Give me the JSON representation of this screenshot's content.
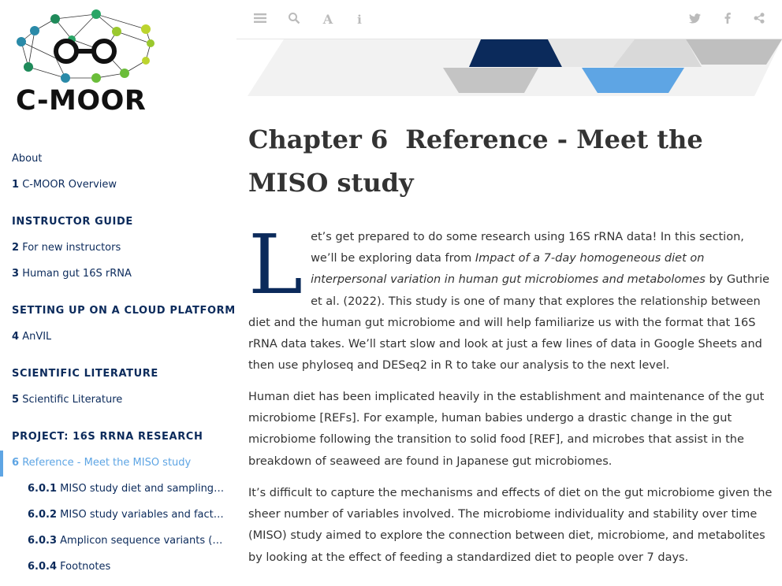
{
  "brand": {
    "logo_text": "C-MOOR",
    "colors": {
      "navy": "#0b2a5b",
      "accent": "#5ea5e4",
      "green": "#1f8a5a",
      "lime": "#9ac82e",
      "teal": "#2a8aa8"
    }
  },
  "sidebar": {
    "about": "About",
    "ch1": {
      "num": "1",
      "label": "C-MOOR Overview"
    },
    "sec_instructor": "Instructor Guide",
    "ch2": {
      "num": "2",
      "label": "For new instructors"
    },
    "ch3": {
      "num": "3",
      "label": "Human gut 16S rRNA"
    },
    "sec_cloud": "Setting up on a cloud platform",
    "ch4": {
      "num": "4",
      "label": "AnVIL"
    },
    "sec_lit": "Scientific Literature",
    "ch5": {
      "num": "5",
      "label": "Scientific Literature"
    },
    "sec_project": "Project: 16S rRNA Research",
    "ch6": {
      "num": "6",
      "label": "Reference - Meet the MISO study"
    },
    "s601": {
      "num": "6.0.1",
      "label": "MISO study diet and sampling s…"
    },
    "s602": {
      "num": "6.0.2",
      "label": "MISO study variables and factors"
    },
    "s603": {
      "num": "6.0.3",
      "label": "Amplicon sequence variants (A…"
    },
    "s604": {
      "num": "6.0.4",
      "label": "Footnotes"
    }
  },
  "toolbar": {
    "left_icons": [
      "menu-icon",
      "search-icon",
      "font-icon",
      "info-icon"
    ],
    "right_icons": [
      "twitter-icon",
      "facebook-icon",
      "share-icon"
    ]
  },
  "chapter": {
    "num": "Chapter 6",
    "title": "Reference - Meet the MISO study"
  },
  "content": {
    "dropcap": "L",
    "p1_a": "et’s get prepared to do some research using 16S rRNA data! In this section, we’ll be exploring data from ",
    "p1_em": "Impact of a 7-day homogeneous diet on interpersonal variation in human gut microbiomes and metabolomes",
    "p1_b": " by Guthrie et al. (2022). This study is one of many that explores the relationship between diet and the human gut microbiome and will help familiarize us with the format that 16S rRNA data takes. We’ll start slow and look at just a few lines of data in Google Sheets and then use phyloseq and DESeq2 in R to take our analysis to the next level.",
    "p2": "Human diet has been implicated heavily in the establishment and maintenance of the gut microbiome [REFs]. For example, human babies undergo a drastic change in the gut microbiome following the transition to solid food [REF], and microbes that assist in the breakdown of seaweed are found in Japanese gut microbiomes.",
    "p3": "It’s difficult to capture the mechanisms and effects of diet on the gut microbiome given the sheer number of variables involved. The microbiome individuality and stability over time (MISO) study aimed to explore the connection between diet, microbiome, and metabolites by looking at the effect of feeding a standardized diet to people over 7 days."
  }
}
